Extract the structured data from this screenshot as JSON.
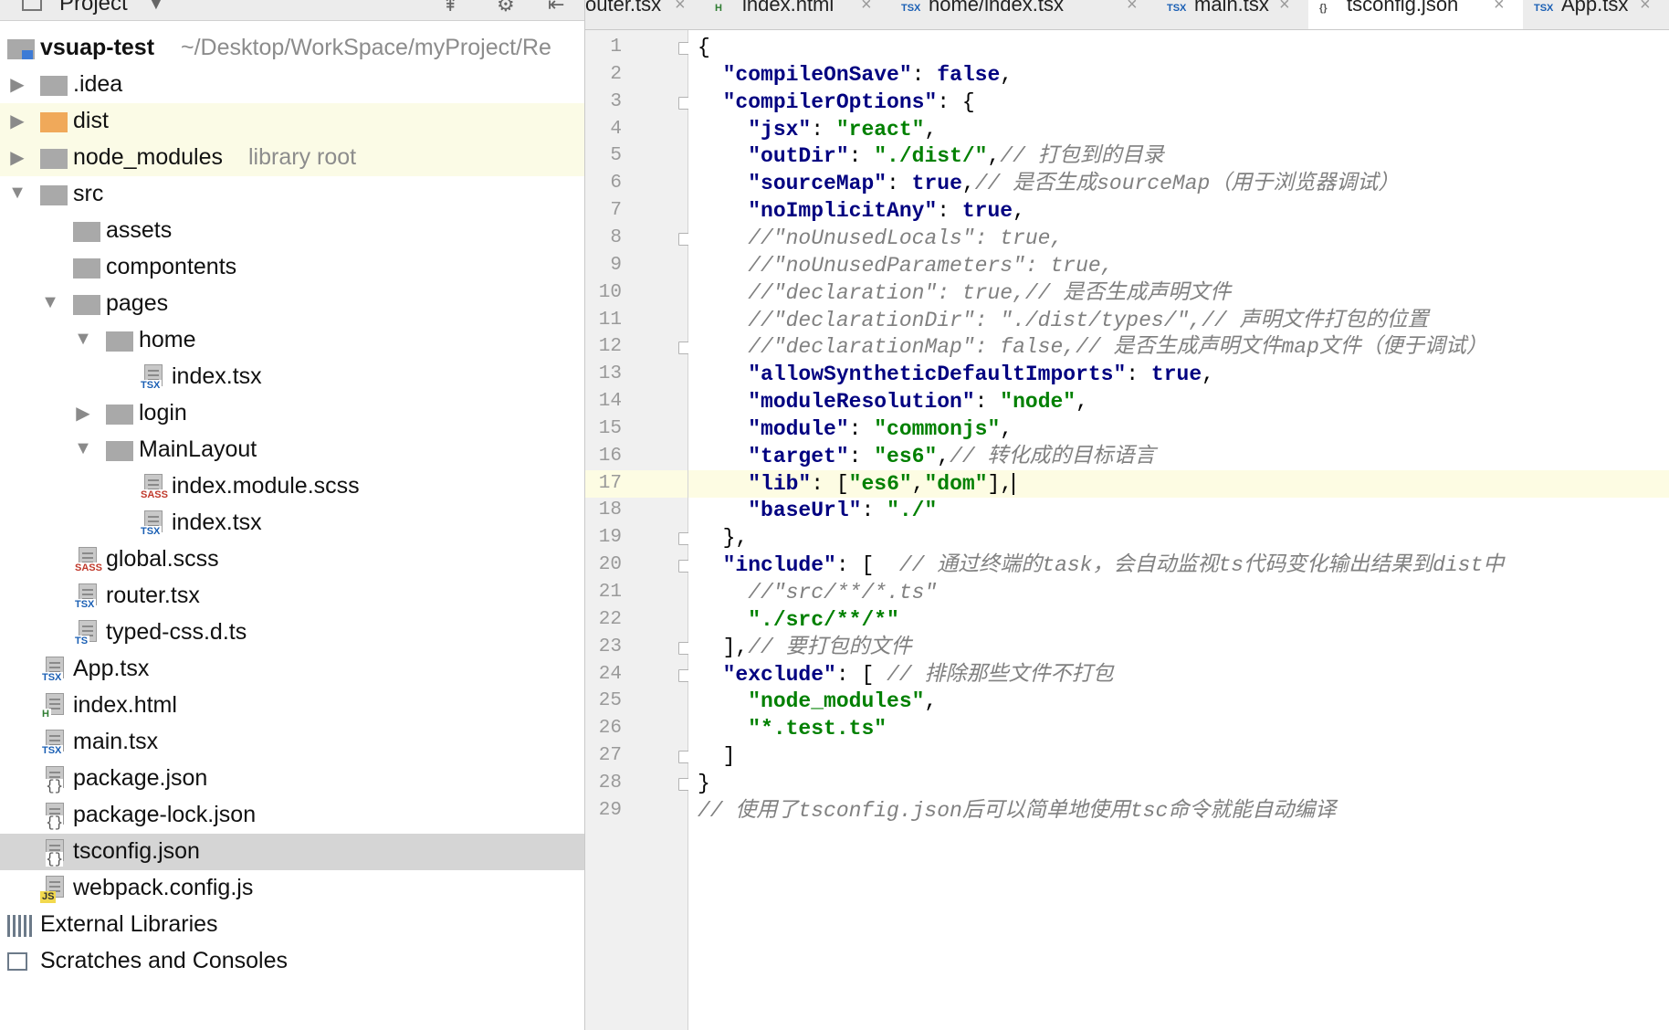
{
  "project_panel": {
    "title": "Project",
    "root_name": "vsuap-test",
    "root_path": "~/Desktop/WorkSpace/myProject/Re",
    "library_root_label": "library root",
    "items": [
      {
        "label": "vsuap-test"
      },
      {
        "label": ".idea"
      },
      {
        "label": "dist"
      },
      {
        "label": "node_modules"
      },
      {
        "label": "src"
      },
      {
        "label": "assets"
      },
      {
        "label": "compontents"
      },
      {
        "label": "pages"
      },
      {
        "label": "home"
      },
      {
        "label": "index.tsx"
      },
      {
        "label": "login"
      },
      {
        "label": "MainLayout"
      },
      {
        "label": "index.module.scss"
      },
      {
        "label": "index.tsx"
      },
      {
        "label": "global.scss"
      },
      {
        "label": "router.tsx"
      },
      {
        "label": "typed-css.d.ts"
      },
      {
        "label": "App.tsx"
      },
      {
        "label": "index.html"
      },
      {
        "label": "main.tsx"
      },
      {
        "label": "package.json"
      },
      {
        "label": "package-lock.json"
      },
      {
        "label": "tsconfig.json"
      },
      {
        "label": "webpack.config.js"
      },
      {
        "label": "External Libraries"
      },
      {
        "label": "Scratches and Consoles"
      }
    ],
    "file_tags": {
      "tsx": "TSX",
      "sass": "SASS",
      "ts": "TS",
      "html": "H",
      "js": "JS"
    }
  },
  "tabs": [
    {
      "label": "outer.tsx",
      "tag": ""
    },
    {
      "label": "index.html",
      "tag": "H"
    },
    {
      "label": "home/index.tsx",
      "tag": "TSX"
    },
    {
      "label": "main.tsx",
      "tag": "TSX"
    },
    {
      "label": "tsconfig.json",
      "tag": "{}"
    },
    {
      "label": "App.tsx",
      "tag": "TSX"
    }
  ],
  "editor": {
    "current_line": 17,
    "line_numbers": [
      "1",
      "2",
      "3",
      "4",
      "5",
      "6",
      "7",
      "8",
      "9",
      "10",
      "11",
      "12",
      "13",
      "14",
      "15",
      "16",
      "17",
      "18",
      "19",
      "20",
      "21",
      "22",
      "23",
      "24",
      "25",
      "26",
      "27",
      "28",
      "29"
    ],
    "lines": [
      "{",
      "  \"compileOnSave\": false,",
      "  \"compilerOptions\": {",
      "    \"jsx\": \"react\",",
      "    \"outDir\": \"./dist/\",// 打包到的目录",
      "    \"sourceMap\": true,// 是否生成sourceMap（用于浏览器调试）",
      "    \"noImplicitAny\": true,",
      "    //\"noUnusedLocals\": true,",
      "    //\"noUnusedParameters\": true,",
      "    //\"declaration\": true,// 是否生成声明文件",
      "    //\"declarationDir\": \"./dist/types/\",// 声明文件打包的位置",
      "    //\"declarationMap\": false,// 是否生成声明文件map文件（便于调试）",
      "    \"allowSyntheticDefaultImports\": true,",
      "    \"moduleResolution\": \"node\",",
      "    \"module\": \"commonjs\",",
      "    \"target\": \"es6\",// 转化成的目标语言",
      "    \"lib\": [\"es6\",\"dom\"],",
      "    \"baseUrl\": \"./\"",
      "  },",
      "  \"include\": [  // 通过终端的task，会自动监视ts代码变化输出结果到dist中",
      "    //\"src/**/*.ts\"",
      "    \"./src/**/*\"",
      "  ],// 要打包的文件",
      "  \"exclude\": [ // 排除那些文件不打包",
      "    \"node_modules\",",
      "    \"*.test.ts\"",
      "  ]",
      "}",
      "// 使用了tsconfig.json后可以简单地使用tsc命令就能自动编译"
    ]
  },
  "colors": {
    "key": "#000080",
    "string": "#008000",
    "comment": "#808080",
    "current_line": "#fdfce3",
    "gutter": "#f0f0f0",
    "selection": "#d5d5d5",
    "highlight_row": "#fbfbe6"
  }
}
